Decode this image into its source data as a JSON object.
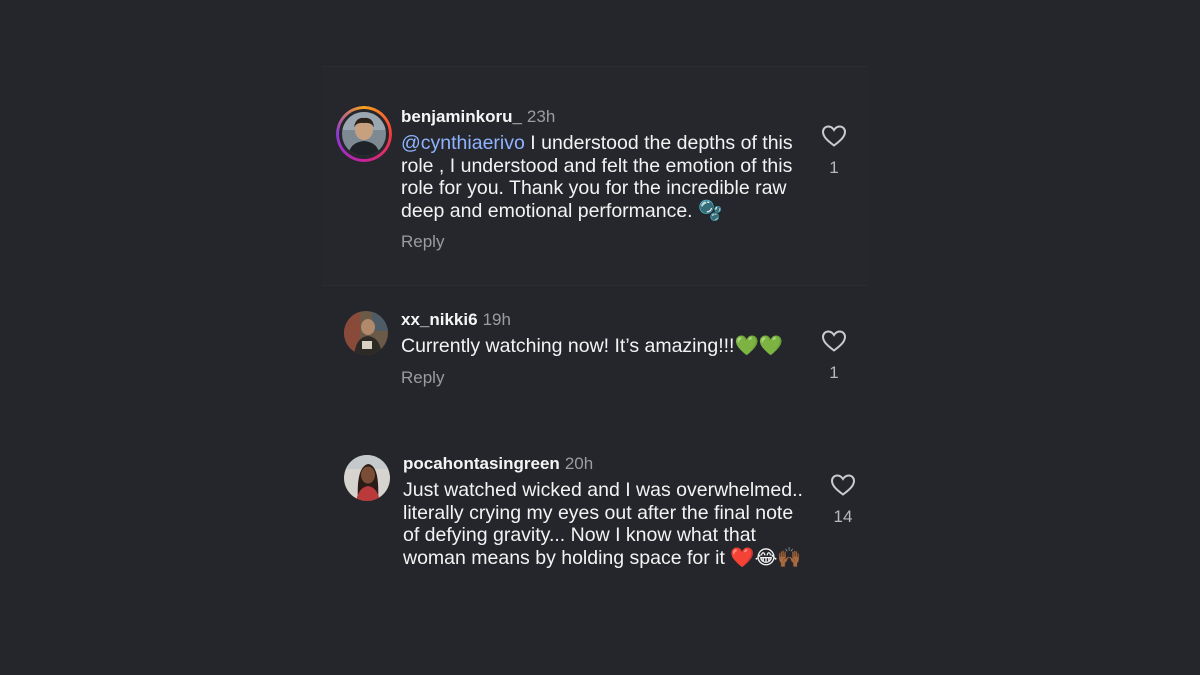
{
  "comments": [
    {
      "username": "benjaminkoru_",
      "time": "23h",
      "mention": "@cynthiaerivo",
      "text": " I understood the depths of this role , I understood and felt the emotion of this role for you. Thank you for the incredible raw deep and emotional performance. ",
      "emoji": "🫧",
      "reply_label": "Reply",
      "likes": "1",
      "has_story_ring": true
    },
    {
      "username": "xx_nikki6",
      "time": "19h",
      "text": "Currently watching now! It’s amazing!!!",
      "emoji": "💚💚",
      "reply_label": "Reply",
      "likes": "1",
      "has_story_ring": false
    },
    {
      "username": "pocahontasingreen",
      "time": "20h",
      "text": "Just watched wicked and I was overwhelmed.. literally crying my eyes out after the final note of defying gravity... Now I know what that woman means by holding space for it ",
      "emoji": "❤️😂🙌🏾",
      "likes": "14",
      "has_story_ring": false
    }
  ],
  "colors": {
    "background": "#24262b",
    "mention": "#8fb3ff",
    "muted": "#9a9ca2",
    "text": "#f3f3f3"
  },
  "icons": {
    "like": "heart-outline-icon"
  }
}
